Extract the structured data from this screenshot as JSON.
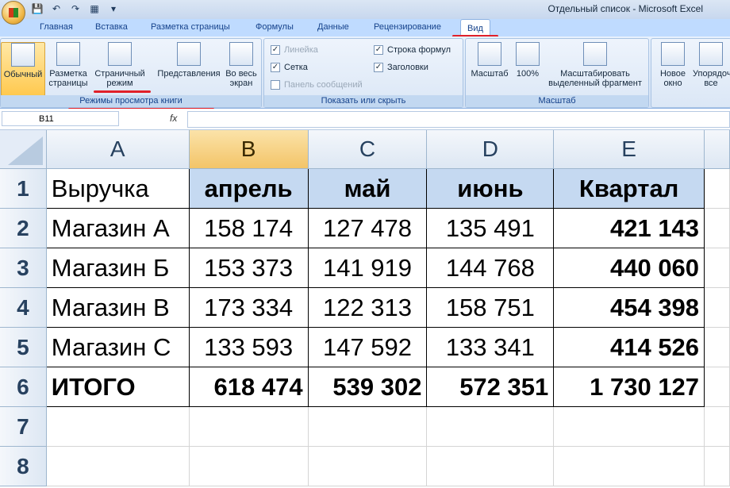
{
  "window": {
    "title": "Отдельный список - Microsoft Excel"
  },
  "tabs": [
    "Главная",
    "Вставка",
    "Разметка страницы",
    "Формулы",
    "Данные",
    "Рецензирование",
    "Вид"
  ],
  "active_tab": "Вид",
  "ribbon": {
    "views_group": {
      "label": "Режимы просмотра книги",
      "buttons": [
        "Обычный",
        "Разметка страницы",
        "Страничный режим",
        "Представления",
        "Во весь экран"
      ]
    },
    "show_group": {
      "label": "Показать или скрыть",
      "checks": [
        {
          "label": "Линейка",
          "checked": true,
          "disabled": true
        },
        {
          "label": "Сетка",
          "checked": true,
          "disabled": false
        },
        {
          "label": "Панель сообщений",
          "checked": false,
          "disabled": true
        },
        {
          "label": "Строка формул",
          "checked": true,
          "disabled": false
        },
        {
          "label": "Заголовки",
          "checked": true,
          "disabled": false
        }
      ]
    },
    "zoom_group": {
      "label": "Масштаб",
      "buttons": [
        "Масштаб",
        "100%",
        "Масштабировать выделенный фрагмент"
      ]
    },
    "window_group": {
      "buttons": [
        "Новое окно",
        "Упорядочить все"
      ]
    }
  },
  "formula_bar": {
    "name_box": "B11",
    "fx": "fx",
    "value": ""
  },
  "columns": [
    "A",
    "B",
    "C",
    "D",
    "E"
  ],
  "rows": [
    "1",
    "2",
    "3",
    "4",
    "5",
    "6",
    "7",
    "8"
  ],
  "table": {
    "header": [
      "Выручка",
      "апрель",
      "май",
      "июнь",
      "Квартал"
    ],
    "body": [
      [
        "Магазин А",
        "158 174",
        "127 478",
        "135 491",
        "421 143"
      ],
      [
        "Магазин Б",
        "153 373",
        "141 919",
        "144 768",
        "440 060"
      ],
      [
        "Магазин В",
        "173 334",
        "122 313",
        "158 751",
        "454 398"
      ],
      [
        "Магазин С",
        "133 593",
        "147 592",
        "133 341",
        "414 526"
      ]
    ],
    "total": [
      "ИТОГО",
      "618 474",
      "539 302",
      "572 351",
      "1 730 127"
    ]
  },
  "colors": {
    "accent_underline": "#e0202a",
    "header_fill": "#c5d9f1",
    "selected_col": "#f3c468"
  }
}
